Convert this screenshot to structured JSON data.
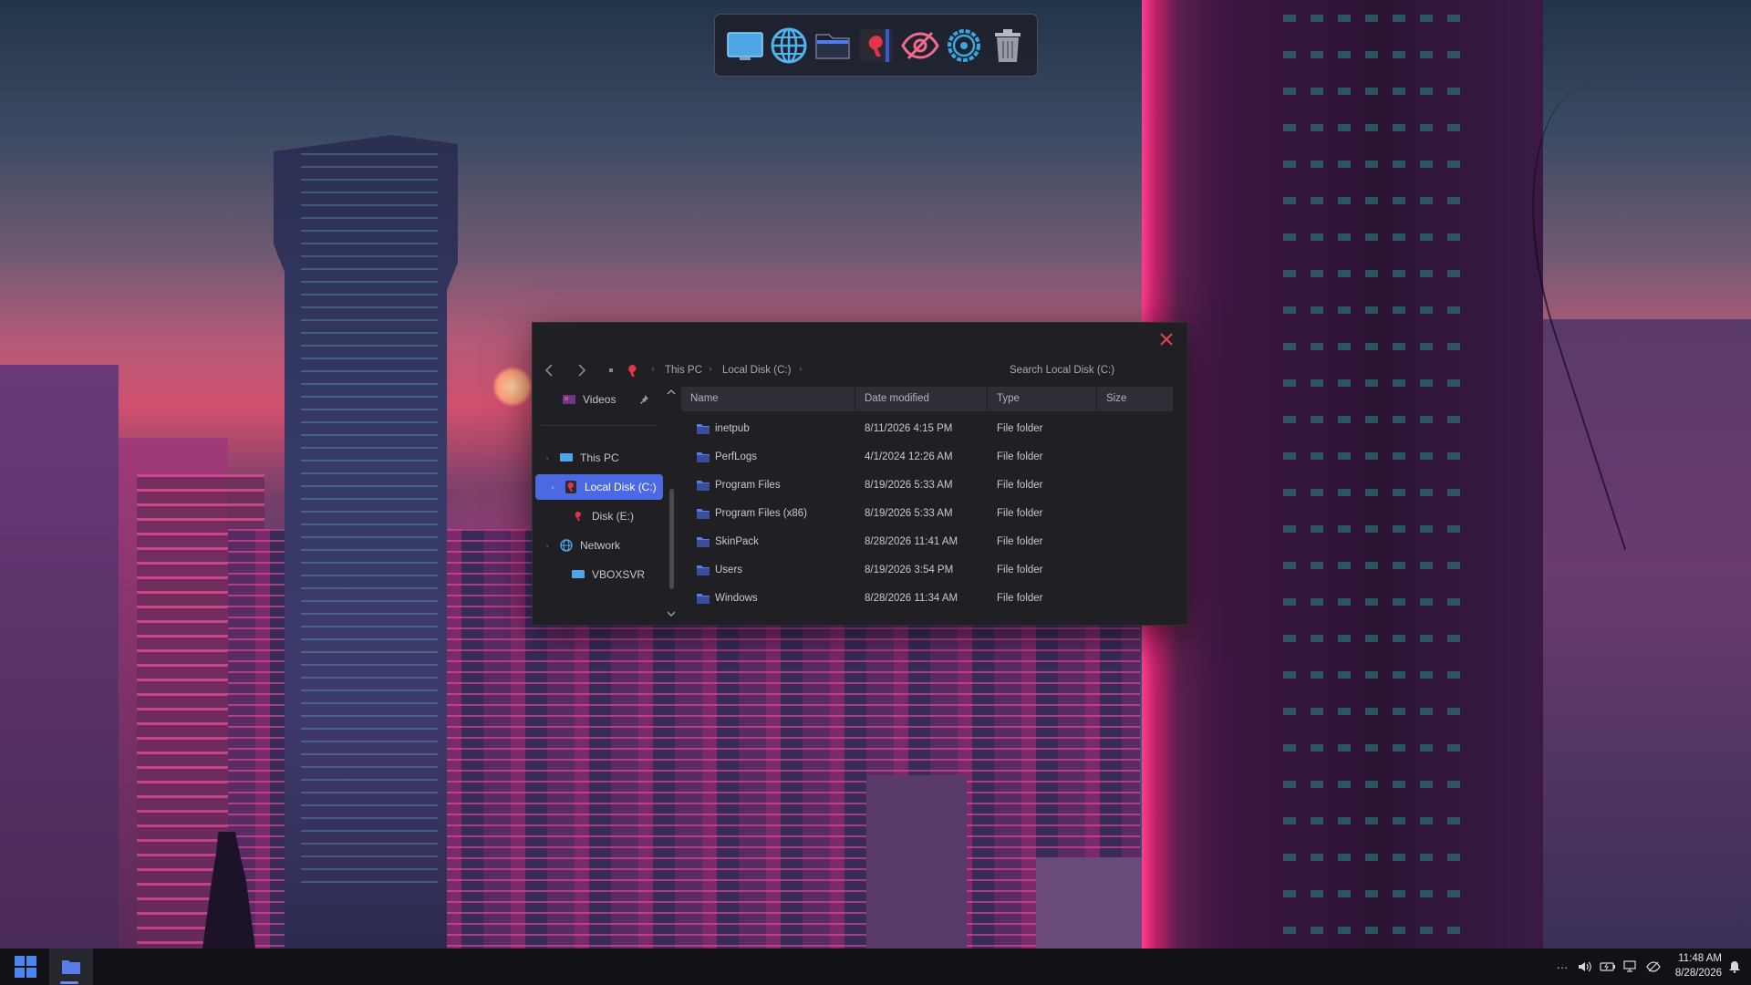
{
  "dock": {
    "items": [
      {
        "id": "desktop",
        "icon": "monitor-icon"
      },
      {
        "id": "browser",
        "icon": "globe-icon"
      },
      {
        "id": "files",
        "icon": "folder-icon"
      },
      {
        "id": "app",
        "icon": "brand-q-icon"
      },
      {
        "id": "viewer",
        "icon": "eye-icon"
      },
      {
        "id": "settings",
        "icon": "gear-icon"
      },
      {
        "id": "trash",
        "icon": "trash-icon"
      }
    ]
  },
  "explorer": {
    "breadcrumb": [
      "This PC",
      "Local Disk (C:)"
    ],
    "search_placeholder": "Search Local Disk (C:)",
    "nav": {
      "quick_item": "Videos",
      "this_pc": "This PC",
      "local_disk": "Local Disk (C:)",
      "disk_e": "Disk (E:)",
      "network": "Network",
      "vboxsvr": "VBOXSVR"
    },
    "columns": {
      "name": "Name",
      "date": "Date modified",
      "type": "Type",
      "size": "Size"
    },
    "rows": [
      {
        "name": "inetpub",
        "date": "8/11/2026 4:15 PM",
        "type": "File folder"
      },
      {
        "name": "PerfLogs",
        "date": "4/1/2024 12:26 AM",
        "type": "File folder"
      },
      {
        "name": "Program Files",
        "date": "8/19/2026 5:33 AM",
        "type": "File folder"
      },
      {
        "name": "Program Files (x86)",
        "date": "8/19/2026 5:33 AM",
        "type": "File folder"
      },
      {
        "name": "SkinPack",
        "date": "8/28/2026 11:41 AM",
        "type": "File folder"
      },
      {
        "name": "Users",
        "date": "8/19/2026 3:54 PM",
        "type": "File folder"
      },
      {
        "name": "Windows",
        "date": "8/28/2026 11:34 AM",
        "type": "File folder"
      }
    ]
  },
  "taskbar": {
    "overflow_label": "···",
    "time": "11:48 AM",
    "date": "8/28/2026"
  },
  "colors": {
    "accent": "#4c68e2",
    "close": "#e0454e",
    "folder": "#5a7ce8"
  }
}
